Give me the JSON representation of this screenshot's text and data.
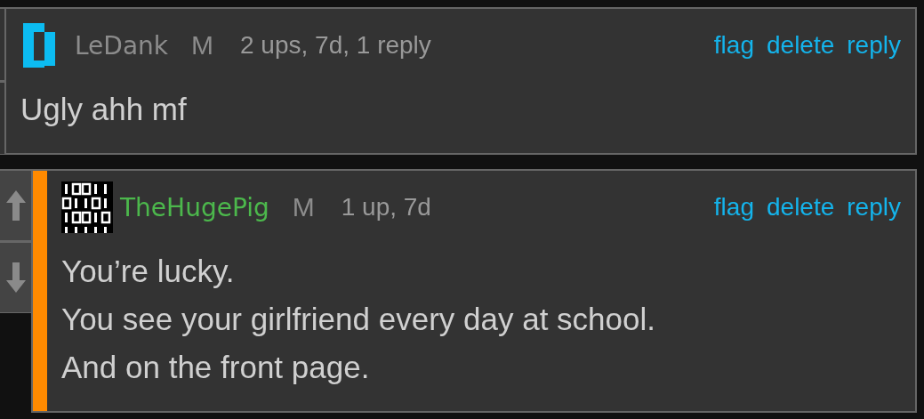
{
  "comments": [
    {
      "votes": {
        "kind": "clipped"
      },
      "highlighted": false,
      "avatar": {
        "kind": "bracket"
      },
      "author": {
        "name": "LeDank",
        "color": "#8c8c8c"
      },
      "gender": "M",
      "meta": "2 ups, 7d, 1 reply",
      "actions": [
        "flag",
        "delete",
        "reply"
      ],
      "text": "Ugly ahh mf"
    },
    {
      "votes": {
        "kind": "shown"
      },
      "highlighted": true,
      "avatar": {
        "kind": "binary"
      },
      "author": {
        "name": "TheHugePig",
        "color": "#4cb84c"
      },
      "gender": "M",
      "meta": "1 up, 7d",
      "actions": [
        "flag",
        "delete",
        "reply"
      ],
      "text": "You’re lucky.\nYou see your girlfriend every day at school.\nAnd on the front page."
    }
  ]
}
